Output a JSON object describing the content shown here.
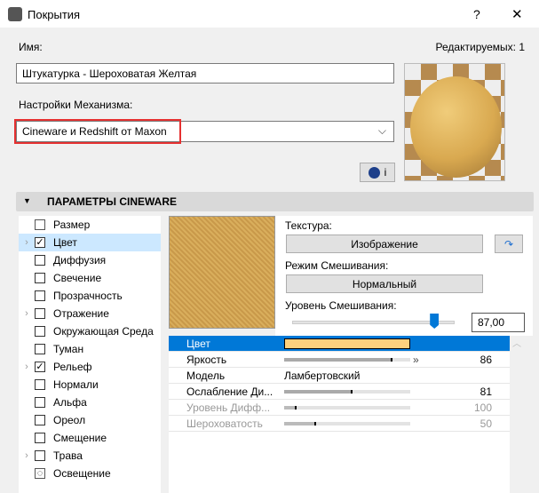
{
  "window": {
    "title": "Покрытия",
    "help": "?",
    "close": "✕"
  },
  "name_label": "Имя:",
  "editable": "Редактируемых: 1",
  "name_value": "Штукатурка - Шероховатая Желтая",
  "engine_label": "Настройки Механизма:",
  "engine_value": "Cineware и Redshift от Maxon",
  "info_button": "i",
  "section_title": "ПАРАМЕТРЫ CINEWARE",
  "tree": [
    {
      "label": "Размер",
      "type": "icon",
      "expand": false
    },
    {
      "label": "Цвет",
      "checked": true,
      "expand": true,
      "selected": true
    },
    {
      "label": "Диффузия",
      "checked": false
    },
    {
      "label": "Свечение",
      "checked": false
    },
    {
      "label": "Прозрачность",
      "checked": false
    },
    {
      "label": "Отражение",
      "checked": false,
      "expand": true
    },
    {
      "label": "Окружающая Среда",
      "checked": false
    },
    {
      "label": "Туман",
      "checked": false
    },
    {
      "label": "Рельеф",
      "checked": true,
      "expand": true
    },
    {
      "label": "Нормали",
      "checked": false
    },
    {
      "label": "Альфа",
      "checked": false
    },
    {
      "label": "Ореол",
      "checked": false
    },
    {
      "label": "Смещение",
      "checked": false
    },
    {
      "label": "Трава",
      "checked": false,
      "expand": true
    },
    {
      "label": "Освещение",
      "type": "icon"
    }
  ],
  "texture_label": "Текстура:",
  "texture_button": "Изображение",
  "blend_mode_label": "Режим Смешивания:",
  "blend_mode_button": "Нормальный",
  "blend_level_label": "Уровень Смешивания:",
  "blend_level_value": "87,00",
  "blend_level_fraction": 0.87,
  "color_swatch": "#fdd17e",
  "props": [
    {
      "label": "Цвет",
      "selected": true
    },
    {
      "label": "Яркость",
      "value": "86",
      "fraction": 0.86
    },
    {
      "label": "Модель",
      "text": "Ламбертовский"
    },
    {
      "label": "Ослабление Ди...",
      "value": "81",
      "fraction": 0.54
    },
    {
      "label": "Уровень Дифф...",
      "value": "100",
      "fraction": 0.1,
      "disabled": true
    },
    {
      "label": "Шероховатость",
      "value": "50",
      "fraction": 0.25,
      "disabled": true
    }
  ]
}
